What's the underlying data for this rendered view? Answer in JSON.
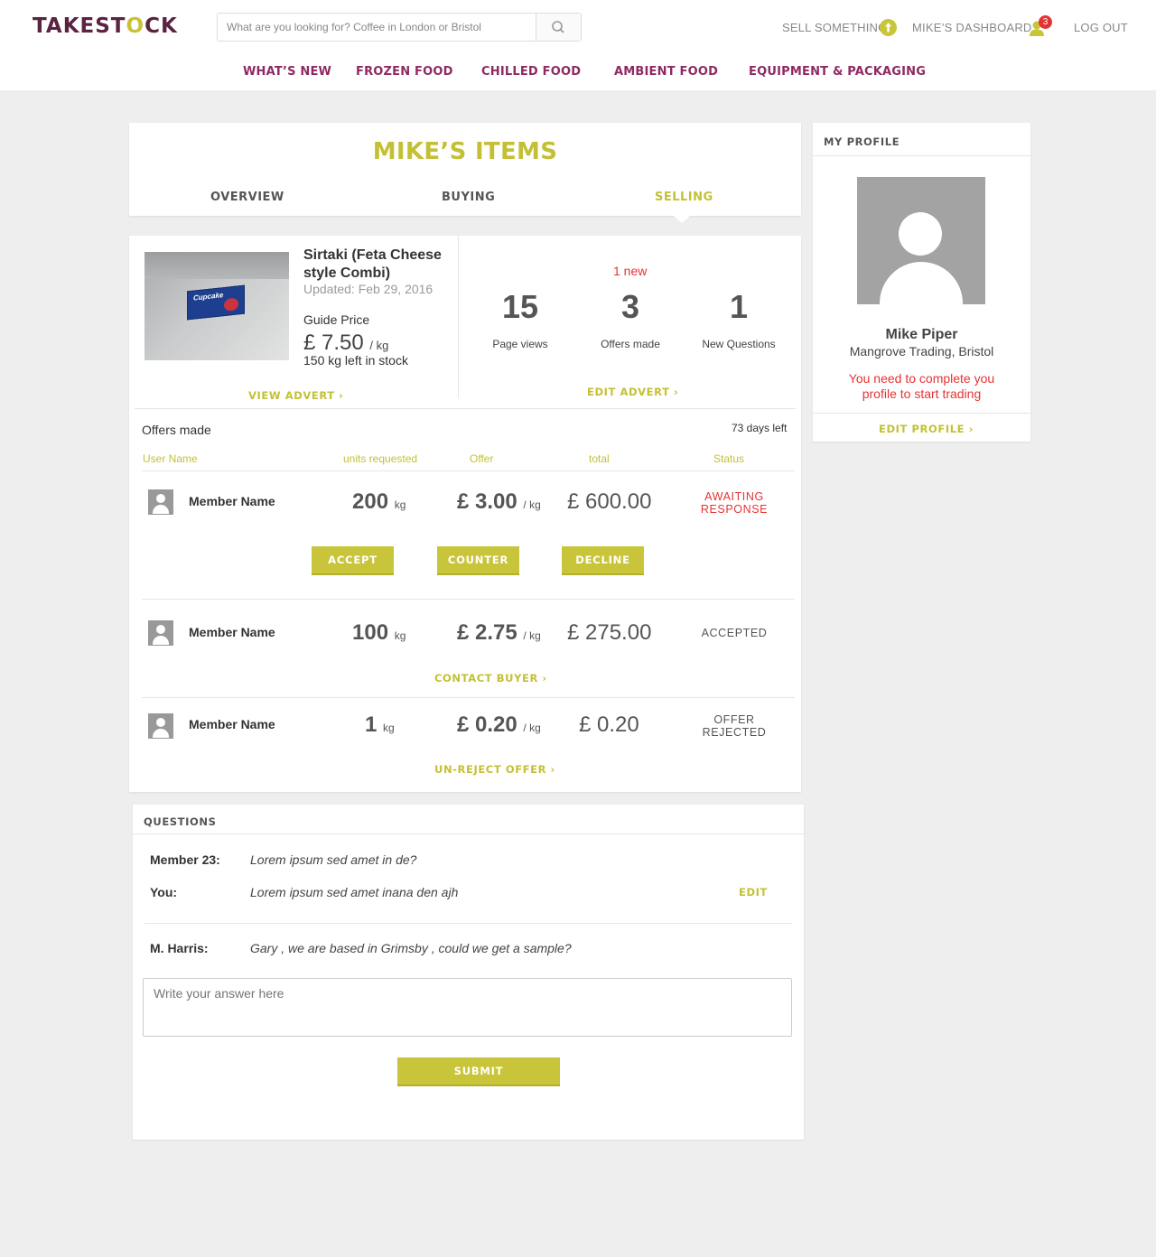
{
  "header": {
    "logo": {
      "before": "TAKEST",
      "accent": "O",
      "after": "CK"
    },
    "search": {
      "placeholder": "What are you looking for? Coffee in London or Bristol"
    },
    "sell_something": "SELL SOMETHING",
    "dashboard": "MIKE’S DASHBOARD",
    "notification_count": "3",
    "logout": "LOG OUT"
  },
  "nav": {
    "whats_new": "WHAT’S NEW",
    "frozen": "FROZEN FOOD",
    "chilled": "CHILLED FOOD",
    "ambient": "AMBIENT FOOD",
    "equipment": "EQUIPMENT & PACKAGING"
  },
  "items": {
    "title": "MIKE’S ITEMS",
    "tabs": {
      "overview": "OVERVIEW",
      "buying": "BUYING",
      "selling": "SELLING"
    },
    "active_tab": "SELLING"
  },
  "product": {
    "name": "Sirtaki (Feta Cheese style Combi)",
    "updated": "Updated: Feb 29, 2016",
    "guide_label": "Guide Price",
    "price": "£ 7.50",
    "price_unit": "/ kg",
    "stock": "150 kg left in stock",
    "package_label": "Cupcake",
    "view_advert": "VIEW ADVERT",
    "edit_advert": "EDIT ADVERT",
    "new_badge": "1 new",
    "stats": [
      {
        "value": "15",
        "label": "Page views"
      },
      {
        "value": "3",
        "label": "Offers made"
      },
      {
        "value": "1",
        "label": "New Questions"
      }
    ]
  },
  "offers": {
    "title": "Offers made",
    "days_left": "73 days left",
    "columns": [
      "User Name",
      "units requested",
      "Offer",
      "total",
      "Status"
    ],
    "rows": [
      {
        "member": "Member Name",
        "units": "200",
        "units_unit": "kg",
        "offer": "£ 3.00",
        "offer_unit": "/ kg",
        "total": "£ 600.00",
        "status_line1": "AWAITING",
        "status_line2": "RESPONSE"
      },
      {
        "member": "Member Name",
        "units": "100",
        "units_unit": "kg",
        "offer": "£ 2.75",
        "offer_unit": "/ kg",
        "total": "£ 275.00",
        "status_line1": "ACCEPTED",
        "status_line2": ""
      },
      {
        "member": "Member Name",
        "units": "1",
        "units_unit": "kg",
        "offer": "£ 0.20",
        "offer_unit": "/ kg",
        "total": "£ 0.20",
        "status_line1": "OFFER",
        "status_line2": "REJECTED"
      }
    ],
    "actions": {
      "accept": "ACCEPT",
      "counter": "COUNTER",
      "decline": "DECLINE"
    },
    "contact_buyer": "CONTACT BUYER",
    "unreject": "UN-REJECT OFFER"
  },
  "questions": {
    "title": "QUESTIONS",
    "items": [
      {
        "label": "Member 23:",
        "text": "Lorem ipsum sed amet in de?"
      },
      {
        "label": "You:",
        "text": "Lorem ipsum sed amet inana den ajh"
      },
      {
        "label": "M. Harris:",
        "text": "Gary , we are based in Grimsby , could we get a sample?"
      }
    ],
    "edit": "EDIT",
    "answer_placeholder": "Write your answer here",
    "submit": "SUBMIT"
  },
  "profile": {
    "heading": "MY PROFILE",
    "name": "Mike Piper",
    "company": "Mangrove Trading, Bristol",
    "warning": "You need to complete you profile to start trading",
    "edit_profile": "EDIT PROFILE"
  },
  "colors": {
    "brand": "#5a2340",
    "nav": "#8e2a62",
    "accent": "#c9c53b",
    "alert": "#e53333"
  }
}
